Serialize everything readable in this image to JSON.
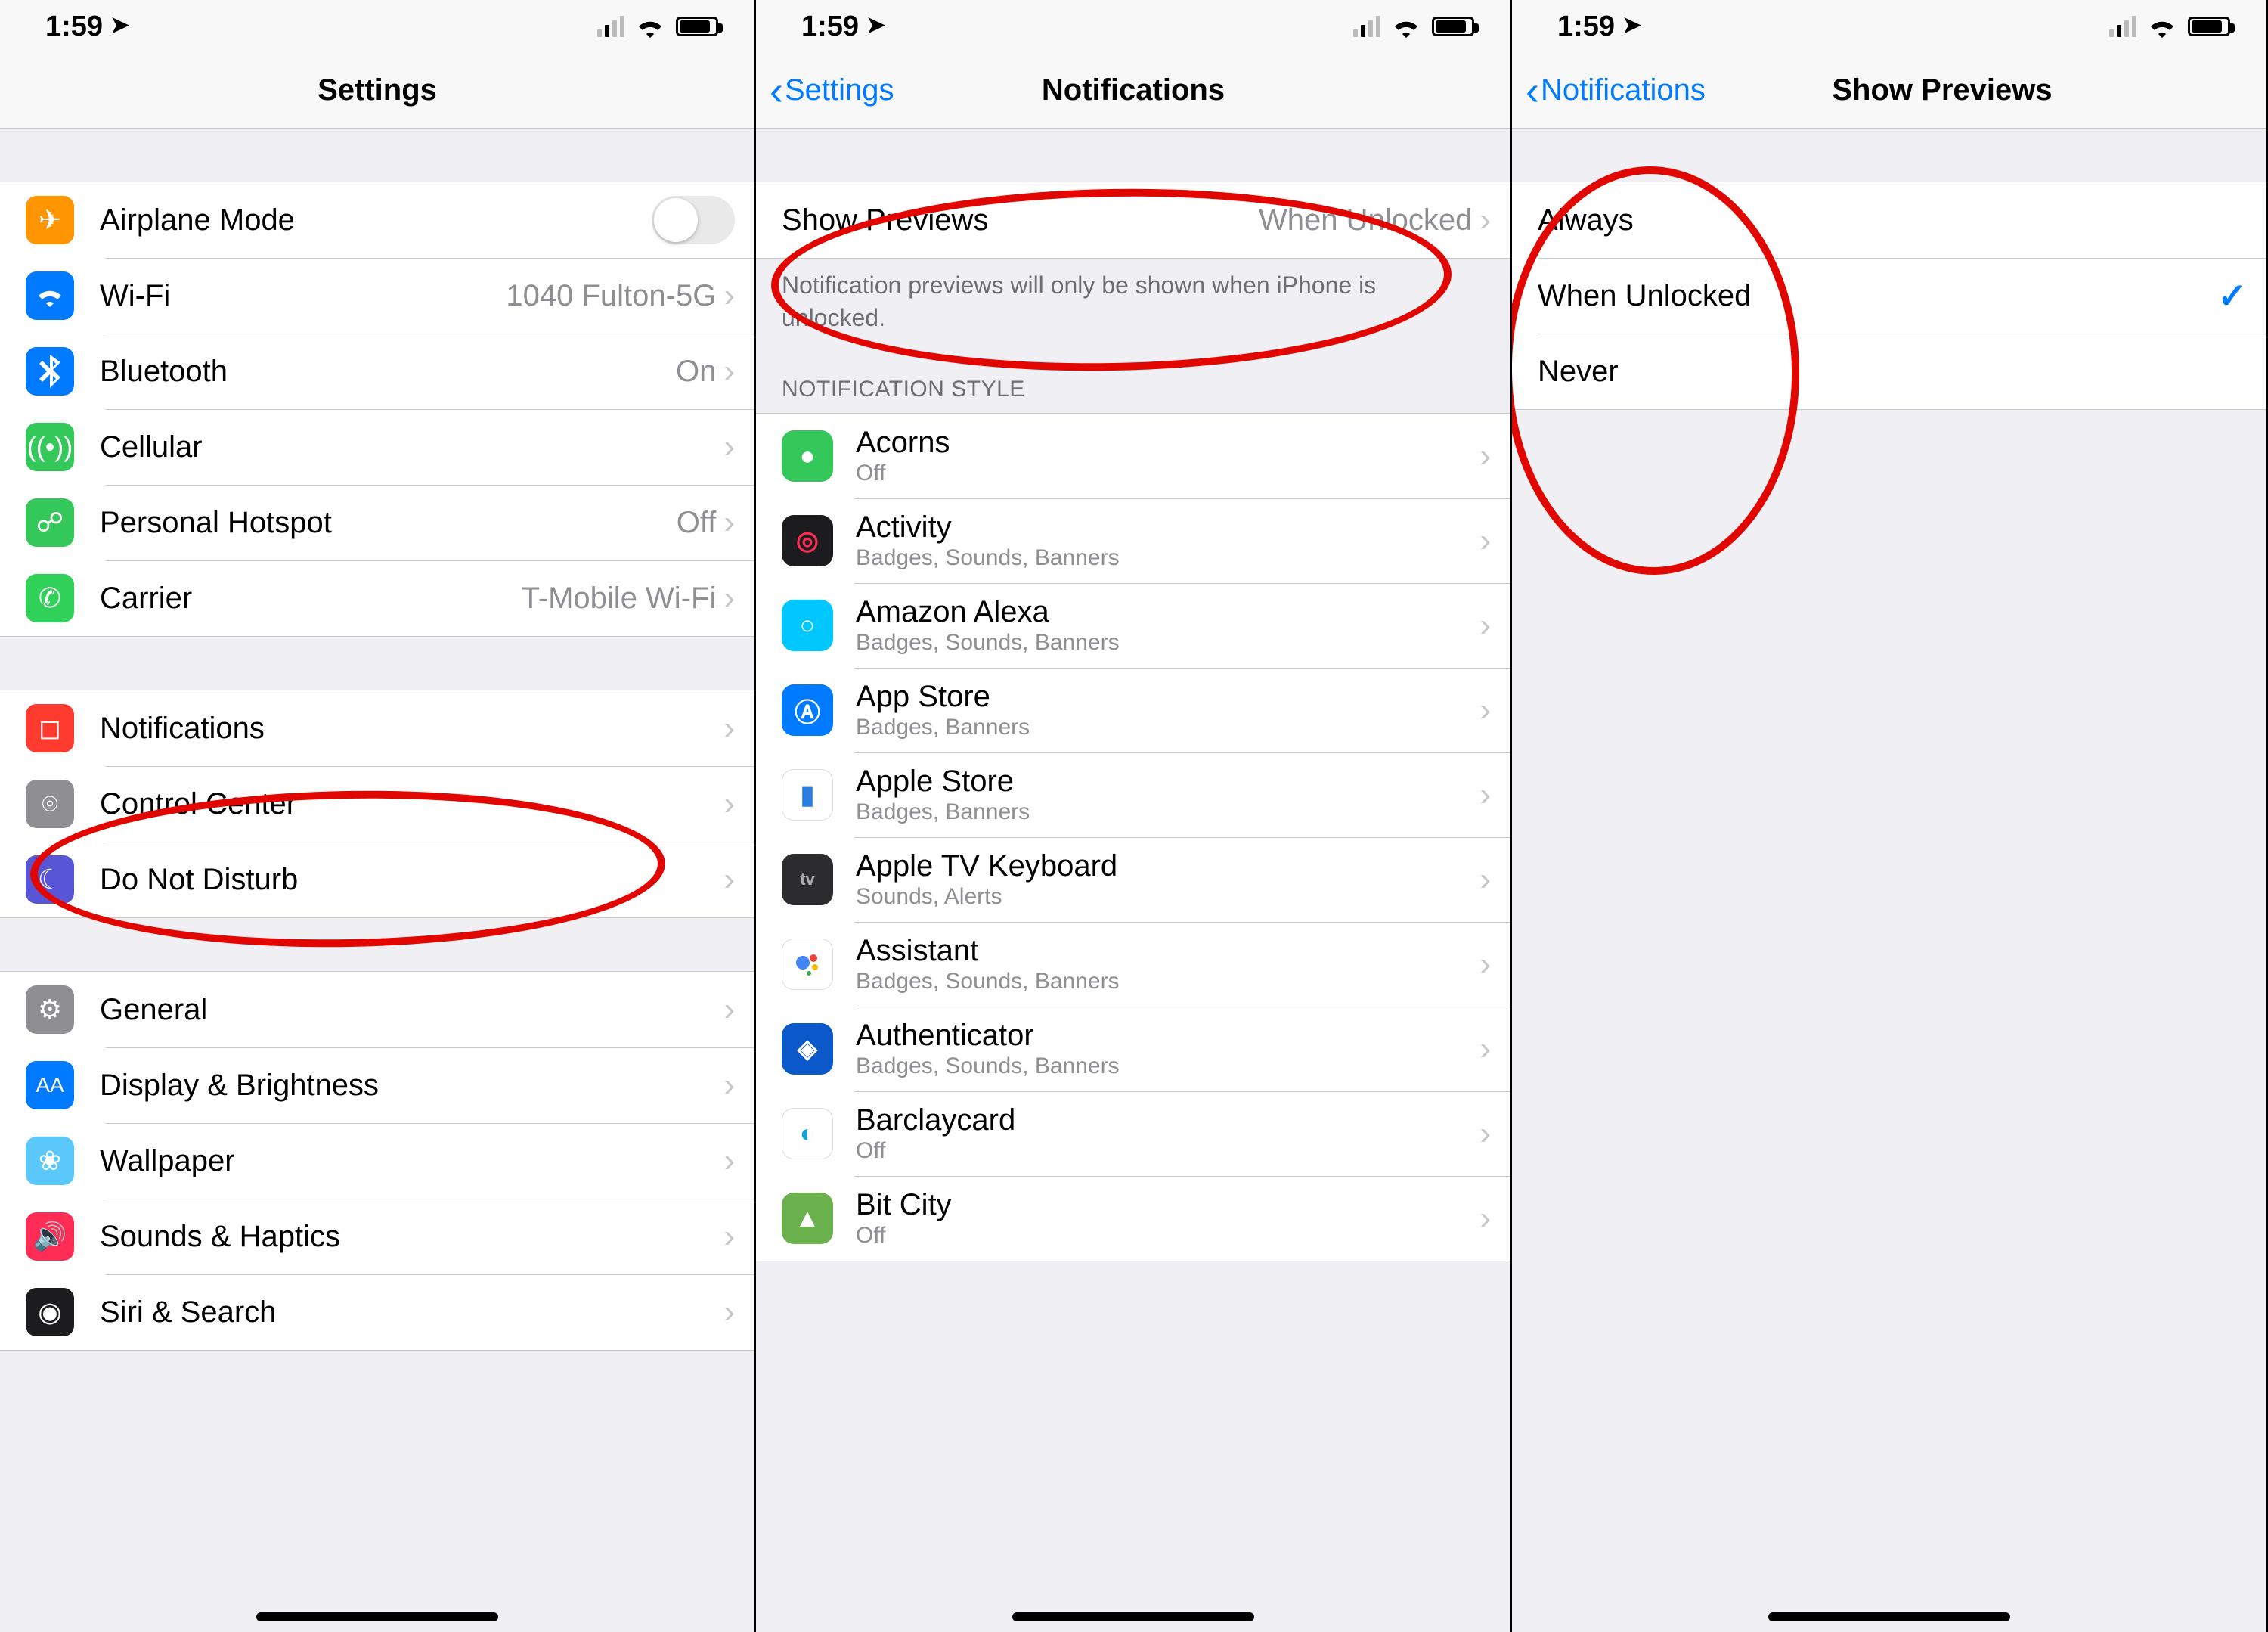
{
  "status": {
    "time": "1:59"
  },
  "panel1": {
    "title": "Settings",
    "group1": [
      {
        "label": "Airplane Mode",
        "kind": "switch",
        "icon": "airplane-icon",
        "color": "bg-orange"
      },
      {
        "label": "Wi-Fi",
        "detail": "1040 Fulton-5G",
        "icon": "wifi-icon",
        "color": "bg-blue"
      },
      {
        "label": "Bluetooth",
        "detail": "On",
        "icon": "bluetooth-icon",
        "color": "bg-blue"
      },
      {
        "label": "Cellular",
        "detail": "",
        "icon": "cellular-icon",
        "color": "bg-green"
      },
      {
        "label": "Personal Hotspot",
        "detail": "Off",
        "icon": "hotspot-icon",
        "color": "bg-green"
      },
      {
        "label": "Carrier",
        "detail": "T-Mobile Wi-Fi",
        "icon": "carrier-icon",
        "color": "bg-phone"
      }
    ],
    "group2": [
      {
        "label": "Notifications",
        "icon": "notifications-icon",
        "color": "bg-red"
      },
      {
        "label": "Control Center",
        "icon": "control-center-icon",
        "color": "bg-gray"
      },
      {
        "label": "Do Not Disturb",
        "icon": "dnd-icon",
        "color": "bg-indigo"
      }
    ],
    "group3": [
      {
        "label": "General",
        "icon": "general-icon",
        "color": "bg-gray"
      },
      {
        "label": "Display & Brightness",
        "icon": "display-icon",
        "color": "bg-blue"
      },
      {
        "label": "Wallpaper",
        "icon": "wallpaper-icon",
        "color": "bg-teal"
      },
      {
        "label": "Sounds & Haptics",
        "icon": "sounds-icon",
        "color": "bg-pink"
      },
      {
        "label": "Siri & Search",
        "icon": "siri-icon",
        "color": "bg-black"
      }
    ]
  },
  "panel2": {
    "back": "Settings",
    "title": "Notifications",
    "show_previews_label": "Show Previews",
    "show_previews_value": "When Unlocked",
    "footer": "Notification previews will only be shown when iPhone is unlocked.",
    "style_header": "NOTIFICATION STYLE",
    "apps": [
      {
        "title": "Acorns",
        "sub": "Off",
        "color": "bg-green",
        "glyph": "●"
      },
      {
        "title": "Activity",
        "sub": "Badges, Sounds, Banners",
        "color": "bg-black",
        "glyph": "◎"
      },
      {
        "title": "Amazon Alexa",
        "sub": "Badges, Sounds, Banners",
        "color": "bg-cyan",
        "glyph": "○"
      },
      {
        "title": "App Store",
        "sub": "Badges, Banners",
        "color": "bg-blue",
        "glyph": "A"
      },
      {
        "title": "Apple Store",
        "sub": "Badges, Banners",
        "color": "bg-white",
        "glyph": "▮"
      },
      {
        "title": "Apple TV Keyboard",
        "sub": "Sounds, Alerts",
        "color": "bg-black",
        "glyph": "tv"
      },
      {
        "title": "Assistant",
        "sub": "Badges, Sounds, Banners",
        "color": "bg-white",
        "glyph": "⠿"
      },
      {
        "title": "Authenticator",
        "sub": "Badges, Sounds, Banners",
        "color": "bg-blue",
        "glyph": "◆"
      },
      {
        "title": "Barclaycard",
        "sub": "Off",
        "color": "bg-white",
        "glyph": "◐"
      },
      {
        "title": "Bit City",
        "sub": "Off",
        "color": "bg-green",
        "glyph": "▲"
      }
    ]
  },
  "panel3": {
    "back": "Notifications",
    "title": "Show Previews",
    "options": [
      {
        "label": "Always",
        "selected": false
      },
      {
        "label": "When Unlocked",
        "selected": true
      },
      {
        "label": "Never",
        "selected": false
      }
    ]
  }
}
